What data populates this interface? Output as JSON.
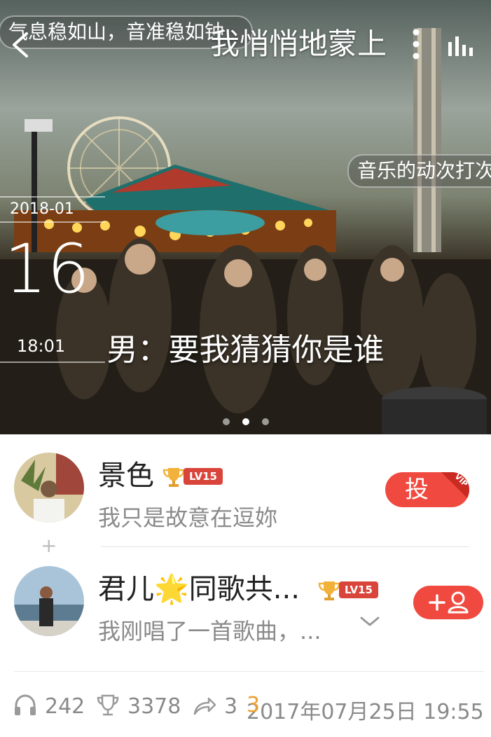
{
  "header": {
    "song_title": "我悄悄地蒙上",
    "danmaku_1": "气息稳如山，音准稳如钟",
    "danmaku_2": "音乐的动次打次"
  },
  "photo": {
    "date_month": "2018-01",
    "date_day": "16",
    "time": "18:01",
    "lyric": "男：要我猜猜你是谁",
    "pages": 3,
    "active_page": 2
  },
  "users": [
    {
      "name": "景色",
      "level": "LV15",
      "message": "我只是故意在逗妳",
      "action": "投",
      "action_tag": "VIP"
    },
    {
      "name": "君儿🌟同歌共...",
      "level": "LV15",
      "message": "我刚唱了一首歌曲，...",
      "action_icon": "add-friend-icon"
    }
  ],
  "stats": {
    "listens": "242",
    "trophies": "3378",
    "shares": "3",
    "timestamp": "2017年07月25日 19:55",
    "timestamp_overlap_digit": "3"
  },
  "colors": {
    "accent": "#f04a40",
    "level_badge": "#d9453b",
    "text_dark": "#222222",
    "text_muted": "#8a8a8a"
  }
}
